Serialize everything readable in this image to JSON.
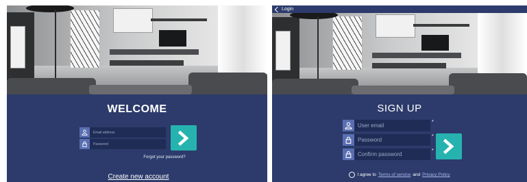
{
  "login": {
    "title": "WELCOME",
    "email_placeholder": "Email address",
    "password_placeholder": "Password",
    "forgot_link": "Forgot your password?",
    "create_link": "Create new account"
  },
  "signup": {
    "back_label": "Login",
    "title": "SIGN UP",
    "email_placeholder": "User email",
    "password_placeholder": "Password",
    "confirm_placeholder": "Confirm password",
    "required_mark": "*",
    "agree_prefix": "I agree to",
    "terms_link": "Terms of service",
    "and_text": "and",
    "privacy_link": "Privacy Policy"
  },
  "icons": {
    "user": "user-icon",
    "lock": "lock-icon",
    "submit": "chevron-right-icon",
    "back": "chevron-left-icon"
  },
  "colors": {
    "panel_bg": "#2c3b6b",
    "field_bg": "#1f2c55",
    "icon_bg": "#5a6fb2",
    "accent": "#26b3b0"
  }
}
